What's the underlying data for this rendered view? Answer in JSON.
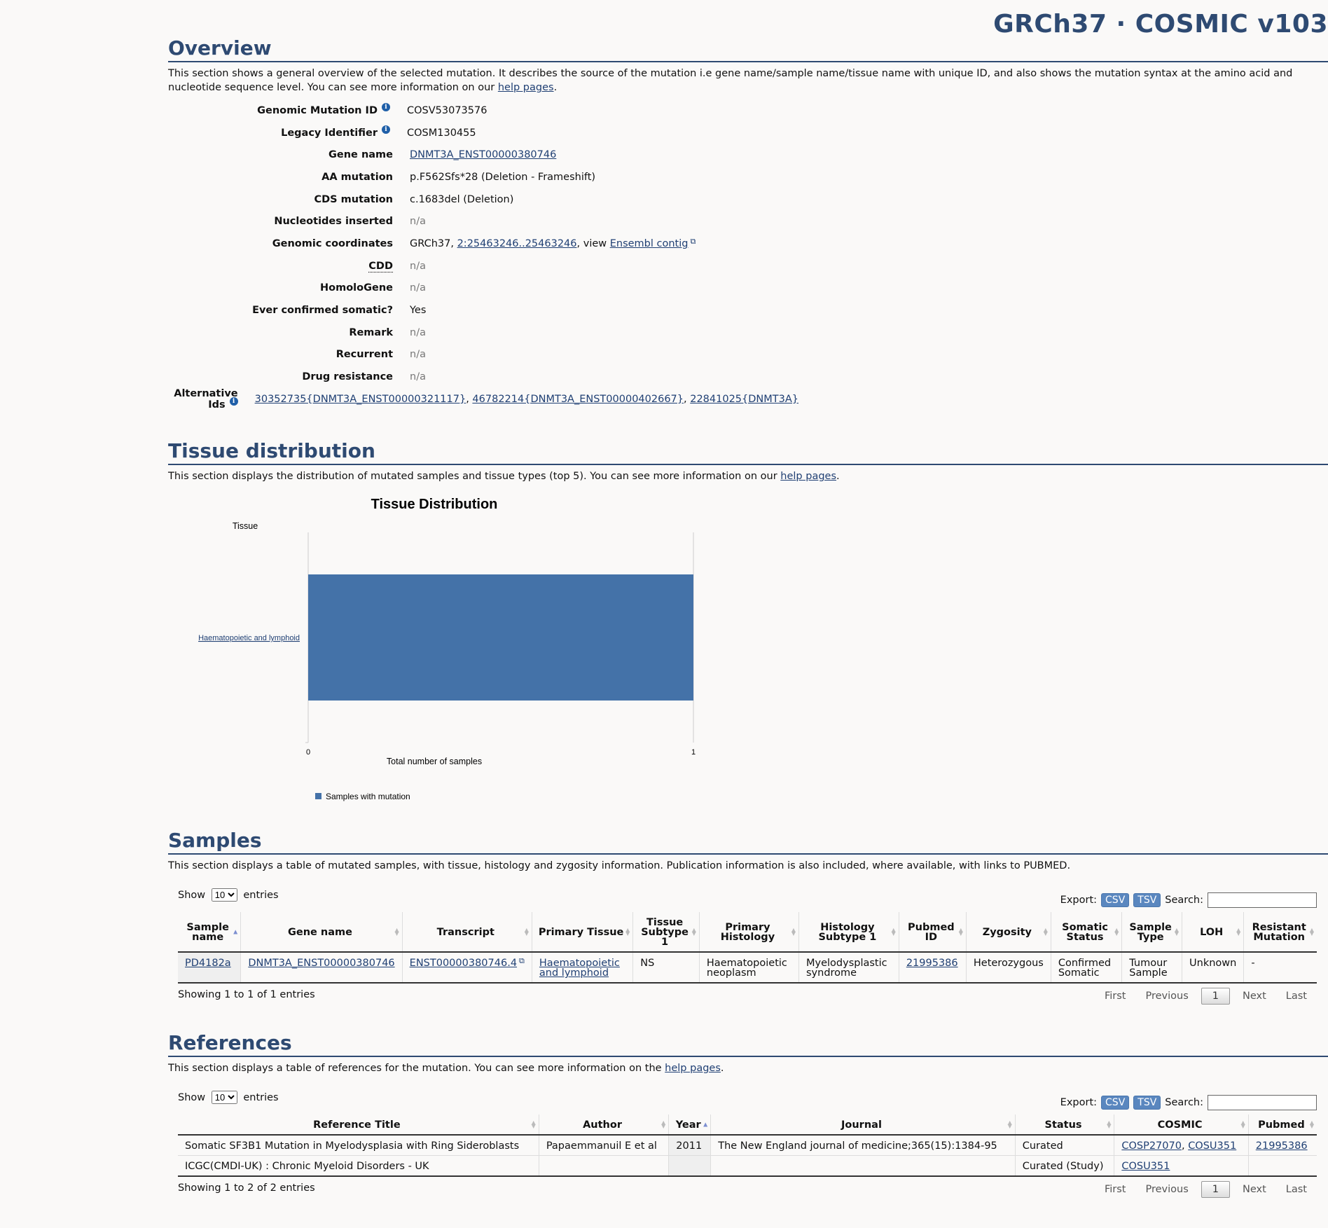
{
  "header": {
    "build": "GRCh37 · COSMIC v103"
  },
  "overview": {
    "title": "Overview",
    "desc_text": "This section shows a general overview of the selected mutation. It describes the source of the mutation i.e gene name/sample name/tissue name with unique ID, and also shows the mutation syntax at the amino acid and nucleotide sequence level. You can see more information on our ",
    "help_link": "help pages",
    "genomic_mutation_id": {
      "label": "Genomic Mutation ID",
      "value": "COSV53073576"
    },
    "legacy_identifier": {
      "label": "Legacy Identifier",
      "value": "COSM130455"
    },
    "gene_name": {
      "label": "Gene name",
      "value": "DNMT3A_ENST00000380746"
    },
    "aa_mutation": {
      "label": "AA mutation",
      "value": "p.F562Sfs*28 (Deletion - Frameshift)"
    },
    "cds_mutation": {
      "label": "CDS mutation",
      "value": "c.1683del (Deletion)"
    },
    "nucleotides_inserted": {
      "label": "Nucleotides inserted",
      "value": "n/a"
    },
    "genomic_coordinates": {
      "label": "Genomic coordinates",
      "prefix": "GRCh37, ",
      "coords_link": "2:25463246..25463246",
      "middle": ", view ",
      "ensembl_link": "Ensembl contig"
    },
    "cdd": {
      "label": "CDD",
      "value": "n/a"
    },
    "homologene": {
      "label": "HomoloGene",
      "value": "n/a"
    },
    "ever_confirmed": {
      "label": "Ever confirmed somatic?",
      "value": "Yes"
    },
    "remark": {
      "label": "Remark",
      "value": "n/a"
    },
    "recurrent": {
      "label": "Recurrent",
      "value": "n/a"
    },
    "drug_resistance": {
      "label": "Drug resistance",
      "value": "n/a"
    },
    "alternative_ids": {
      "label": "Alternative Ids",
      "ids": [
        "30352735{DNMT3A_ENST00000321117}",
        "46782214{DNMT3A_ENST00000402667}",
        "22841025{DNMT3A}"
      ]
    }
  },
  "tissue": {
    "title": "Tissue distribution",
    "desc_text": "This section displays the distribution of mutated samples and tissue types (top 5). You can see more information on our ",
    "help_link": "help pages"
  },
  "chart_data": {
    "type": "bar",
    "orientation": "horizontal",
    "title": "Tissue Distribution",
    "ylabel": "Tissue",
    "xlabel": "Total number of samples",
    "categories": [
      "Haematopoietic and lymphoid"
    ],
    "series": [
      {
        "name": "Samples with mutation",
        "values": [
          1
        ]
      }
    ],
    "xlim": [
      0,
      1
    ],
    "xticks": [
      "0",
      "1"
    ],
    "color": "#4472a8",
    "legend_position": "bottom-left",
    "grid": false
  },
  "samples": {
    "title": "Samples",
    "desc": "This section displays a table of mutated samples, with tissue, histology and zygosity information. Publication information is also included, where available, with links to PUBMED.",
    "show_label": "Show",
    "entries_label": "entries",
    "page_size": "10",
    "export_label": "Export:",
    "csv": "CSV",
    "tsv": "TSV",
    "search_label": "Search:",
    "columns": [
      "Sample name",
      "Gene name",
      "Transcript",
      "Primary Tissue",
      "Tissue Subtype 1",
      "Primary Histology",
      "Histology Subtype 1",
      "Pubmed ID",
      "Zygosity",
      "Somatic Status",
      "Sample Type",
      "LOH",
      "Resistant Mutation"
    ],
    "rows": [
      {
        "sample": "PD4182a",
        "gene": "DNMT3A_ENST00000380746",
        "transcript": "ENST00000380746.4",
        "tissue": "Haematopoietic and lymphoid",
        "subtype": "NS",
        "histology": "Haematopoietic neoplasm",
        "hist_subtype": "Myelodysplastic syndrome",
        "pubmed": "21995386",
        "zygosity": "Heterozygous",
        "somatic": "Confirmed Somatic",
        "sample_type": "Tumour Sample",
        "loh": "Unknown",
        "resistant": "-"
      }
    ],
    "info": "Showing 1 to 1 of 1 entries",
    "pager": {
      "first": "First",
      "previous": "Previous",
      "current": "1",
      "next": "Next",
      "last": "Last"
    }
  },
  "references": {
    "title": "References",
    "desc_text": "This section displays a table of references for the mutation. You can see more information on the ",
    "help_link": "help pages",
    "show_label": "Show",
    "entries_label": "entries",
    "page_size": "10",
    "export_label": "Export:",
    "csv": "CSV",
    "tsv": "TSV",
    "search_label": "Search:",
    "columns": [
      "Reference Title",
      "Author",
      "Year",
      "Journal",
      "Status",
      "COSMIC",
      "Pubmed"
    ],
    "rows": [
      {
        "title": "Somatic SF3B1 Mutation in Myelodysplasia with Ring Sideroblasts",
        "author": "Papaemmanuil E et al",
        "year": "2011",
        "journal": "The New England journal of medicine;365(15):1384-95",
        "status": "Curated",
        "cosmic": [
          "COSP27070",
          "COSU351"
        ],
        "pubmed": "21995386"
      },
      {
        "title": "ICGC(CMDI-UK) : Chronic Myeloid Disorders - UK",
        "author": "",
        "year": "",
        "journal": "",
        "status": "Curated (Study)",
        "cosmic": [
          "COSU351"
        ],
        "pubmed": ""
      }
    ],
    "info": "Showing 1 to 2 of 2 entries",
    "pager": {
      "first": "First",
      "previous": "Previous",
      "current": "1",
      "next": "Next",
      "last": "Last"
    }
  }
}
